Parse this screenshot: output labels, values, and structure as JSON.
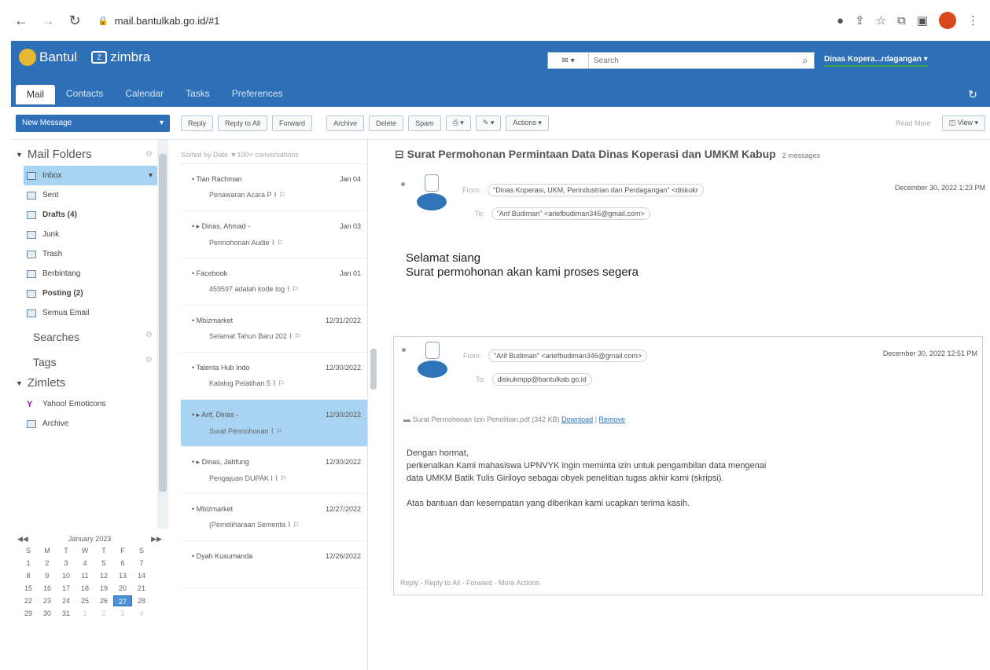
{
  "browser": {
    "url": "mail.bantulkab.go.id/#1"
  },
  "app": {
    "brand": "Bantul",
    "product": "zimbra",
    "tabs": [
      "Mail",
      "Contacts",
      "Calendar",
      "Tasks",
      "Preferences"
    ],
    "search_type": "▾",
    "search_placeholder": "Search",
    "user": "Dinas Kopera...rdagangan ▾"
  },
  "toolbar": {
    "new_message": "New Message",
    "reply": "Reply",
    "reply_all": "Reply to All",
    "forward": "Forward",
    "archive": "Archive",
    "delete": "Delete",
    "spam": "Spam",
    "actions": "Actions ▾",
    "read_more": "Read More",
    "view": "View ▾"
  },
  "folders": {
    "title": "Mail Folders",
    "items": [
      {
        "label": "Inbox",
        "bold": false
      },
      {
        "label": "Sent",
        "bold": false
      },
      {
        "label": "Drafts (4)",
        "bold": true
      },
      {
        "label": "Junk",
        "bold": false
      },
      {
        "label": "Trash",
        "bold": false
      },
      {
        "label": "Berbintang",
        "bold": false
      },
      {
        "label": "Posting (2)",
        "bold": true
      },
      {
        "label": "Semua Email",
        "bold": false
      }
    ],
    "searches": "Searches",
    "tags": "Tags",
    "zimlets": "Zimlets",
    "zimlet_items": [
      "Yahoo! Emoticons",
      "Archive"
    ]
  },
  "calendar": {
    "month": "January 2023",
    "weekdays": [
      "S",
      "M",
      "T",
      "W",
      "T",
      "F",
      "S"
    ],
    "rows": [
      [
        "1",
        "2",
        "3",
        "4",
        "5",
        "6",
        "7"
      ],
      [
        "8",
        "9",
        "10",
        "11",
        "12",
        "13",
        "14"
      ],
      [
        "15",
        "16",
        "17",
        "18",
        "19",
        "20",
        "21"
      ],
      [
        "22",
        "23",
        "24",
        "25",
        "26",
        "27",
        "28"
      ],
      [
        "29",
        "30",
        "31",
        "1",
        "2",
        "3",
        "4"
      ]
    ],
    "today": "27"
  },
  "list": {
    "sort": "Sorted by Date ▼100+ conversations",
    "messages": [
      {
        "from": "Tian Rachman",
        "date": "Jan 04",
        "subject": "Penawaran Acara P"
      },
      {
        "from": "▸ Dinas, Ahmad -",
        "date": "Jan 03",
        "subject": "Permohonan Audie"
      },
      {
        "from": "Facebook",
        "date": "Jan 01",
        "subject": "459597 adalah kode log"
      },
      {
        "from": "Mbizmarket",
        "date": "12/31/2022",
        "subject": "Selamat Tahun Baru 202"
      },
      {
        "from": "Talenta Hub Indo",
        "date": "12/30/2022",
        "subject": "Katalog Pelatihan 5"
      },
      {
        "from": "▸ Arif, Dinas -",
        "date": "12/30/2022",
        "subject": "Surat Permohonan"
      },
      {
        "from": "▸ Dinas, Jabfung",
        "date": "12/30/2022",
        "subject": "Pengajuan DUPAK I"
      },
      {
        "from": "Mbizmarket",
        "date": "12/27/2022",
        "subject": "(Pemeliharaan Sementa"
      },
      {
        "from": "Dyah Kusumanda",
        "date": "12/26/2022",
        "subject": ""
      }
    ]
  },
  "conversation": {
    "title": "Surat Permohonan Permintaan Data Dinas Koperasi dan UMKM Kabup",
    "count": "2 messages",
    "msg1": {
      "from_label": "From:",
      "from": "\"Dinas Koperasi, UKM, Perindustrian dan Perdagangan\" <diskukr",
      "to_label": "To:",
      "to": "\"Arif Budiman\" <ariefbudiman346@gmail.com>",
      "date": "December 30, 2022 1:23 PM",
      "line1": "Selamat siang",
      "line2": "Surat permohonan akan kami proses segera"
    },
    "msg2": {
      "from_label": "From:",
      "from": "\"Arif Budiman\" <ariefbudiman346@gmail.com>",
      "to_label": "To:",
      "to": "diskukmpp@bantulkab.go.id",
      "date": "December 30, 2022 12:51 PM",
      "attachment": "Surat Permohonan Izin Penelitian.pdf (342 KB)",
      "download": "Download",
      "remove": "Remove",
      "greeting": "Dengan hormat,",
      "body1": "perkenalkan Kami mahasiswa UPNVYK ingin meminta izin untuk pengambilan data mengenai",
      "body2": "data UMKM Batik Tulis Giriloyo sebagai obyek penelitian tugas akhir kami (skripsi).",
      "body3": "Atas bantuan dan kesempatan yang diberikan kami ucapkan terima kasih.",
      "actions": "Reply - Reply to All - Forward - More Actions"
    }
  }
}
